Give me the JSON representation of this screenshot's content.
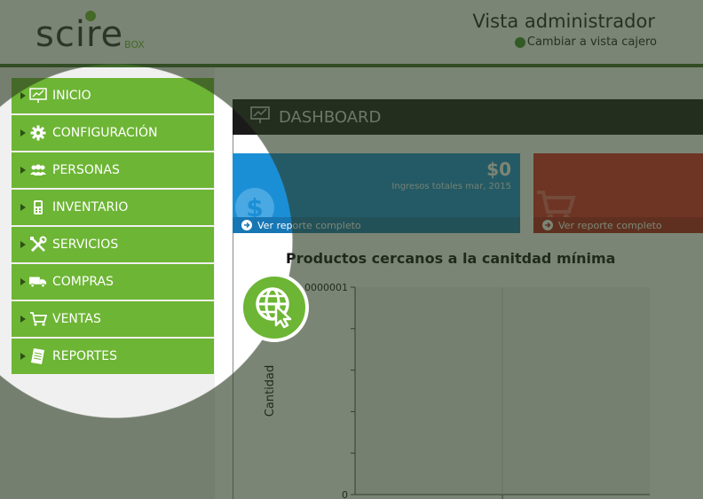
{
  "header": {
    "logo_text": "scire",
    "logo_sub": "BOX",
    "admin_title": "Vista administrador",
    "switch_link": "Cambiar a vista cajero"
  },
  "sidebar": {
    "items": [
      {
        "label": "INICIO",
        "icon": "presentation-chart-icon"
      },
      {
        "label": "CONFIGURACIÓN",
        "icon": "gear-icon"
      },
      {
        "label": "PERSONAS",
        "icon": "people-icon"
      },
      {
        "label": "INVENTARIO",
        "icon": "phone-icon"
      },
      {
        "label": "SERVICIOS",
        "icon": "tools-icon"
      },
      {
        "label": "COMPRAS",
        "icon": "truck-icon"
      },
      {
        "label": "VENTAS",
        "icon": "cart-icon"
      },
      {
        "label": "REPORTES",
        "icon": "report-icon"
      }
    ]
  },
  "dashboard": {
    "title": "DASHBOARD",
    "cards": [
      {
        "value": "$0",
        "label": "Ingresos totales mar, 2015",
        "link": "Ver reporte completo",
        "icon": "dollar-icon",
        "color": "#1b8fd6"
      },
      {
        "value": "",
        "label": "",
        "link": "Ver reporte completo",
        "icon": "cart-icon",
        "color": "#dd2a2a"
      }
    ]
  },
  "chart_data": {
    "type": "bar",
    "title": "Productos cercanos a la canitdad mínima",
    "ylabel": "Cantidad",
    "xlabel": "",
    "categories": [],
    "values": [],
    "ylim": [
      0,
      1e-06
    ],
    "y_tick_labels": [
      "0",
      "0000001"
    ],
    "grid": false
  },
  "tour": {
    "icon": "globe-cursor-icon"
  },
  "colors": {
    "accent": "#6db534",
    "header_rule": "#3f6a2a",
    "overlay": "#2a3a20"
  }
}
